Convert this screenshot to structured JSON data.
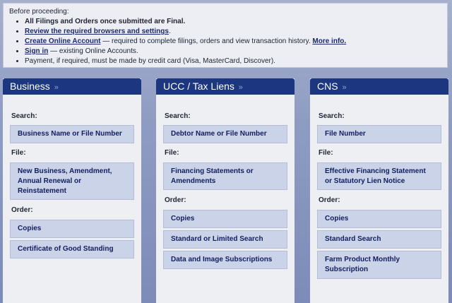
{
  "notice": {
    "intro": "Before proceeding:",
    "final_text": "All Filings and Orders once submitted are Final.",
    "browsers_link": "Review the required browsers and settings",
    "create_link": "Create Online Account",
    "create_desc": " — required to complete filings, orders and view transaction history. ",
    "more_info_link": "More info.",
    "signin_link": "Sign in",
    "signin_desc": " — existing Online Accounts.",
    "payment_text": "Payment, if required, must be made by credit card (Visa, MasterCard, Discover).",
    "period": "."
  },
  "columns": [
    {
      "title": "Business",
      "chevron": "»",
      "search_label": "Search:",
      "search_items": [
        "Business Name or File Number"
      ],
      "file_label": "File:",
      "file_items": [
        "New Business, Amendment, Annual Renewal or Reinstatement"
      ],
      "order_label": "Order:",
      "order_items": [
        "Copies",
        "Certificate of Good Standing"
      ]
    },
    {
      "title": "UCC / Tax Liens",
      "chevron": "»",
      "search_label": "Search:",
      "search_items": [
        "Debtor Name or File Number"
      ],
      "file_label": "File:",
      "file_items": [
        "Financing Statements or Amendments"
      ],
      "order_label": "Order:",
      "order_items": [
        "Copies",
        "Standard or Limited Search",
        "Data and Image Subscriptions"
      ]
    },
    {
      "title": "CNS",
      "chevron": "»",
      "search_label": "Search:",
      "search_items": [
        "File Number"
      ],
      "file_label": "File:",
      "file_items": [
        "Effective Financing Statement or Statutory Lien Notice"
      ],
      "order_label": "Order:",
      "order_items": [
        "Copies",
        "Standard Search",
        "Farm Product Monthly Subscription"
      ]
    }
  ]
}
